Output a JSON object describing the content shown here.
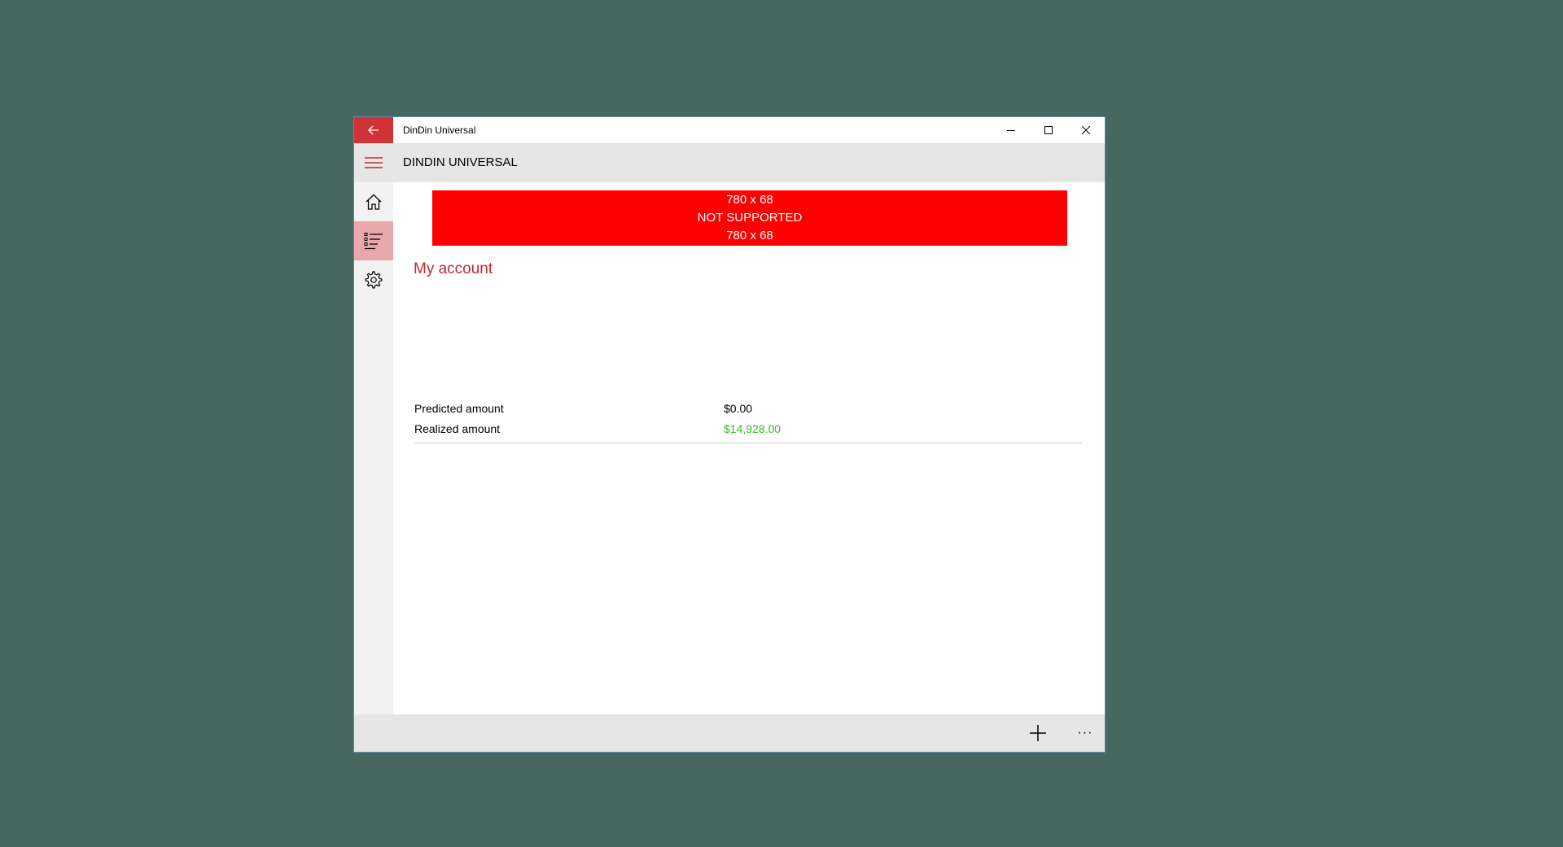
{
  "window": {
    "title": "DinDin Universal"
  },
  "header": {
    "app_name": "DINDIN UNIVERSAL"
  },
  "ad": {
    "line1": "780 x 68",
    "line2": "NOT SUPPORTED",
    "line3": "780 x 68"
  },
  "account": {
    "title": "My account",
    "rows": [
      {
        "label": "Predicted amount",
        "value": "$0.00"
      },
      {
        "label": "Realized amount",
        "value": "$14,928.00"
      }
    ]
  },
  "commandbar": {
    "more": "···"
  },
  "colors": {
    "accent": "#d13438",
    "accent_text": "#c4262e",
    "positive": "#3cb92a",
    "ad_background": "#ff0000",
    "desktop": "#48685f"
  },
  "icons": {
    "back": "arrow-left-icon",
    "minimize": "minimize-icon",
    "maximize": "maximize-icon",
    "close": "close-icon",
    "menu": "hamburger-icon",
    "home": "home-icon",
    "list": "list-icon",
    "settings": "gear-icon",
    "add": "plus-icon",
    "more": "more-icon"
  }
}
